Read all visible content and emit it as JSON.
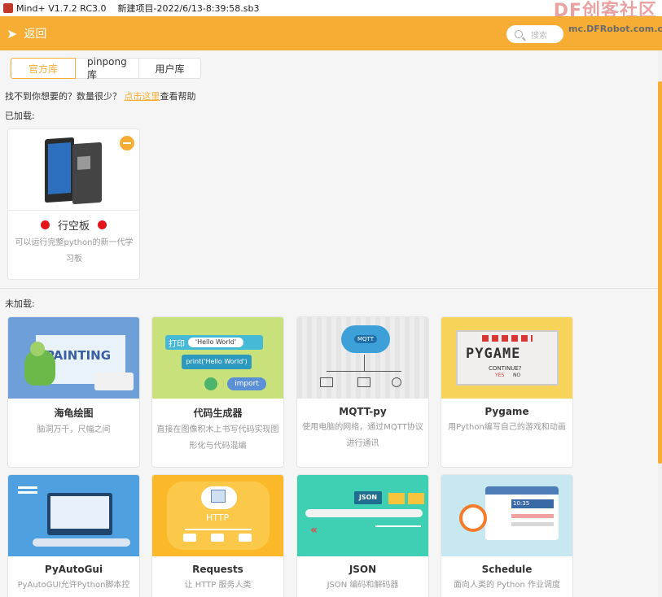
{
  "window": {
    "title": "Mind+ V1.7.2 RC3.0",
    "project": "新建项目-2022/6/13-8:39:58.sb3",
    "watermark_brand": "DF创客社区",
    "watermark_url": "mc.DFRobot.com.cn"
  },
  "topbar": {
    "back_label": "返回",
    "search_placeholder": "搜索"
  },
  "tabs": [
    "官方库",
    "pinpong库",
    "用户库"
  ],
  "help": {
    "prefix": "找不到你想要的？数量很少？",
    "link": "点击这里",
    "suffix": "查看帮助"
  },
  "loaded": {
    "section_label": "已加载:",
    "items": [
      {
        "name": "行空板",
        "desc": "可以运行完整python的新一代学习板"
      }
    ]
  },
  "unloaded": {
    "section_label": "未加载:",
    "items": [
      {
        "name": "海龟绘图",
        "desc": "脑洞万千，尺幅之间"
      },
      {
        "name": "代码生成器",
        "desc": "直接在图像积木上书写代码实现图形化与代码混编"
      },
      {
        "name": "MQTT-py",
        "desc": "使用电脑的网络，通过MQTT协议进行通讯"
      },
      {
        "name": "Pygame",
        "desc": "用Python编写自己的游戏和动画"
      },
      {
        "name": "PyAutoGui",
        "desc": "PyAutoGUI允许Python脚本控"
      },
      {
        "name": "Requests",
        "desc": "让 HTTP 服务人类"
      },
      {
        "name": "JSON",
        "desc": "JSON 编码和解码器"
      },
      {
        "name": "Schedule",
        "desc": "面向人类的 Python 作业调度"
      }
    ]
  },
  "banner_text": {
    "turtle": "PAINTING",
    "code_print": "打印",
    "code_hello": "'Hello World'",
    "code_print_call": "print('Hello World')",
    "code_import": "import",
    "mqtt": "MQTT",
    "pygame": "PYGAME",
    "pygame_continue": "CONTINUE?",
    "pygame_yes": "YES",
    "pygame_no": "NO",
    "http": "HTTP",
    "json": "JSON",
    "sched_time": "10:35"
  },
  "colors": {
    "accent": "#f7ad33",
    "dot_red": "#e3141c"
  }
}
